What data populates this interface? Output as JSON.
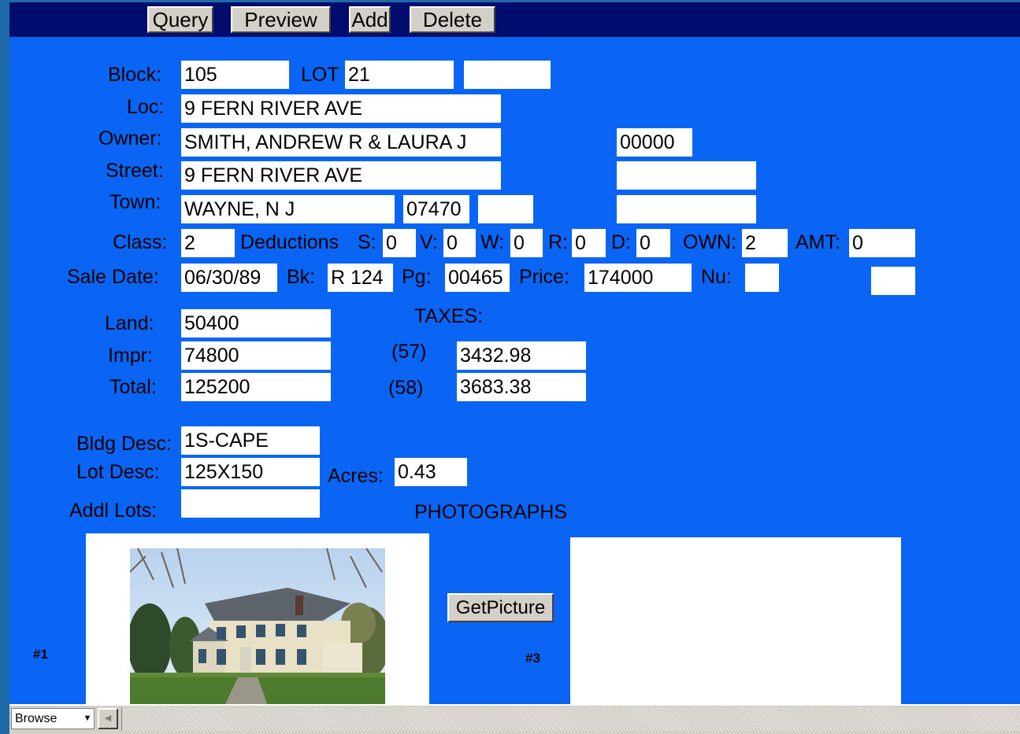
{
  "toolbar": {
    "query_label": "Query",
    "preview_label": "Preview",
    "add_label": "Add",
    "delete_label": "Delete"
  },
  "form": {
    "block_label": "Block:",
    "block_value": "105",
    "lot_label": "LOT",
    "lot_value": "21",
    "lot_extra_value": "",
    "loc_label": "Loc:",
    "loc_value": "9 FERN RIVER AVE",
    "owner_label": "Owner:",
    "owner_value": "SMITH, ANDREW R & LAURA J",
    "owner_code_value": "00000",
    "street_label": "Street:",
    "street_value": "9 FERN RIVER AVE",
    "street_extra_value": "",
    "town_label": "Town:",
    "town_value": "WAYNE, N J",
    "zip_value": "07470",
    "zip_extra_value": "",
    "town_extra_value": "",
    "class_label": "Class:",
    "class_value": "2",
    "deductions_label": "Deductions",
    "s_label": "S:",
    "s_value": "0",
    "v_label": "V:",
    "v_value": "0",
    "w_label": "W:",
    "w_value": "0",
    "r_label": "R:",
    "r_value": "0",
    "d_label": "D:",
    "d_value": "0",
    "own_label": "OWN:",
    "own_value": "2",
    "amt_label": "AMT:",
    "amt_value": "0",
    "sale_date_label": "Sale Date:",
    "sale_date_value": "06/30/89",
    "bk_label": "Bk:",
    "bk_value": "R 124",
    "pg_label": "Pg:",
    "pg_value": "00465",
    "price_label": "Price:",
    "price_value": "174000",
    "nu_label": "Nu:",
    "nu_value": "",
    "nu_extra_value": "",
    "land_label": "Land:",
    "land_value": "50400",
    "impr_label": "Impr:",
    "impr_value": "74800",
    "total_label": "Total:",
    "total_value": "125200",
    "taxes_label": "TAXES:",
    "tax57_label": "(57)",
    "tax57_value": "3432.98",
    "tax58_label": "(58)",
    "tax58_value": "3683.38",
    "bldg_desc_label": "Bldg Desc:",
    "bldg_desc_value": "1S-CAPE",
    "lot_desc_label": "Lot Desc:",
    "lot_desc_value": "125X150",
    "acres_label": "Acres:",
    "acres_value": "0.43",
    "addl_lots_label": "Addl Lots:",
    "addl_lots_value": "",
    "photographs_label": "PHOTOGRAPHS",
    "get_picture_label": "GetPicture",
    "photo1_label": "#1",
    "photo3_label": "#3"
  },
  "status_bar": {
    "mode_value": "Browse"
  },
  "colors": {
    "form_background": "#0a64f4",
    "toolbar_background": "#000c6e",
    "field_background": "#ffffff"
  }
}
